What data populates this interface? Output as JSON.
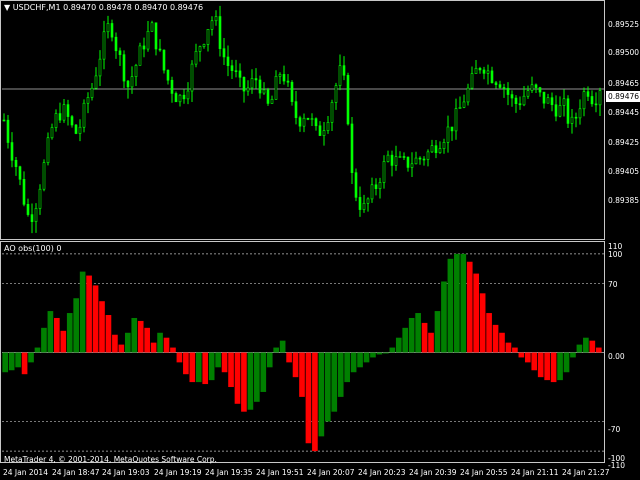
{
  "window": {
    "symbol_title": "USDCHF,M1  0.89470 0.89478 0.89470 0.89476",
    "indicator_title": "AO obs(100) 0",
    "copyright": "MetaTrader 4, © 2001-2014, MetaQuotes Software Corp.",
    "current_price": "0.89476"
  },
  "price_scale": [
    "0.89525",
    "0.89500",
    "0.89465",
    "0.89445",
    "0.89425",
    "0.89405",
    "0.89385"
  ],
  "indicator_scale": [
    "110",
    "100",
    "70",
    "0.00",
    "-70",
    "-100",
    "-110"
  ],
  "time_labels": [
    "24 Jan 2014",
    "24 Jan 18:47",
    "24 Jan 19:03",
    "24 Jan 19:19",
    "24 Jan 19:35",
    "24 Jan 19:51",
    "24 Jan 20:07",
    "24 Jan 20:23",
    "24 Jan 20:39",
    "24 Jan 20:55",
    "24 Jan 21:11",
    "24 Jan 21:27"
  ],
  "colors": {
    "background": "#000000",
    "candles": "#00ff00",
    "histogram_up": "#008000",
    "histogram_down": "#ff0000",
    "grid": "#c0c0c0"
  },
  "chart_data": {
    "type": "candlestick + histogram",
    "symbol": "USDCHF",
    "timeframe": "M1",
    "price_ylim": [
      0.89375,
      0.89535
    ],
    "indicator_ylim": [
      -110,
      110
    ],
    "indicator_levels": [
      100,
      70,
      0,
      -70,
      -100
    ],
    "price_path": [
      0.89455,
      0.89437,
      0.89425,
      0.89408,
      0.8939,
      0.89392,
      0.8941,
      0.89428,
      0.89448,
      0.89458,
      0.89462,
      0.89455,
      0.89445,
      0.89452,
      0.89468,
      0.89478,
      0.89495,
      0.8951,
      0.89522,
      0.89505,
      0.89492,
      0.89478,
      0.89488,
      0.895,
      0.8951,
      0.89518,
      0.89505,
      0.8949,
      0.8948,
      0.89472,
      0.8947,
      0.89478,
      0.89492,
      0.89505,
      0.89512,
      0.89524,
      0.8952,
      0.895,
      0.89492,
      0.89488,
      0.89478,
      0.89474,
      0.8948,
      0.89484,
      0.8947,
      0.89462,
      0.89478,
      0.8949,
      0.89478,
      0.8946,
      0.89455,
      0.8946,
      0.89455,
      0.89445,
      0.8945,
      0.8946,
      0.89475,
      0.89488,
      0.89475,
      0.89415,
      0.894,
      0.89395,
      0.89403,
      0.8941,
      0.8942,
      0.8943,
      0.89428,
      0.89426,
      0.89425,
      0.89427,
      0.89428,
      0.8943,
      0.89433,
      0.89438,
      0.89442,
      0.89447,
      0.89452,
      0.8946,
      0.8947,
      0.89478,
      0.89488,
      0.89494,
      0.89488,
      0.89484,
      0.89482,
      0.89476,
      0.89468,
      0.89466,
      0.89471,
      0.89476,
      0.89475,
      0.8947,
      0.89468,
      0.89465,
      0.89462,
      0.89464,
      0.8945,
      0.89458,
      0.89472,
      0.89476,
      0.89468,
      0.89478
    ],
    "ao_values": [
      -20,
      -18,
      -15,
      -22,
      -10,
      5,
      25,
      42,
      35,
      22,
      40,
      55,
      82,
      78,
      68,
      52,
      38,
      18,
      8,
      20,
      35,
      32,
      25,
      10,
      20,
      15,
      5,
      -10,
      -22,
      -30,
      -30,
      -32,
      -28,
      -15,
      -20,
      -35,
      -52,
      -60,
      -58,
      -50,
      -40,
      -15,
      5,
      12,
      -10,
      -25,
      -45,
      -92,
      -100,
      -85,
      -70,
      -60,
      -45,
      -30,
      -20,
      -15,
      -10,
      -5,
      -2,
      0,
      5,
      15,
      25,
      35,
      40,
      30,
      20,
      42,
      72,
      95,
      100,
      100,
      92,
      80,
      60,
      40,
      28,
      20,
      10,
      5,
      -5,
      -10,
      -18,
      -25,
      -28,
      -30,
      -28,
      -20,
      -5,
      8,
      15,
      12,
      5
    ]
  }
}
